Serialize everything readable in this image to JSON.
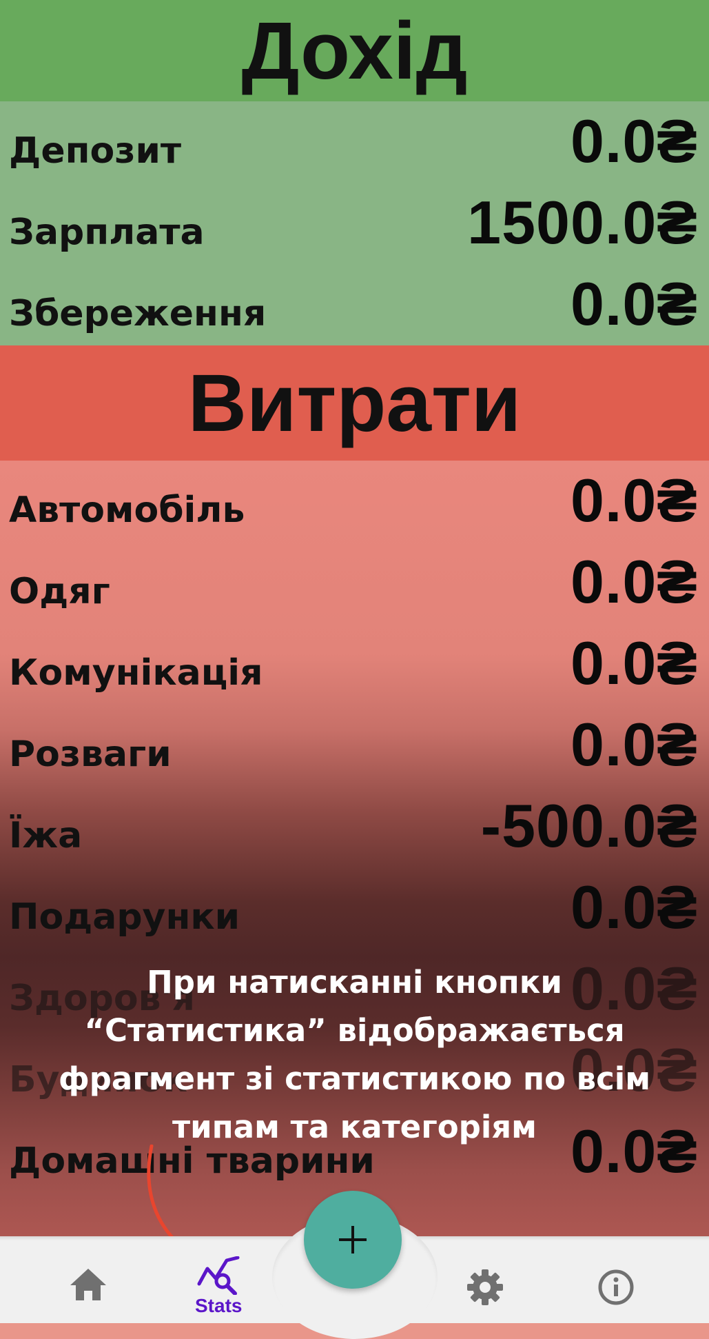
{
  "income": {
    "title": "Дохід",
    "items": [
      {
        "label": "Депозит",
        "value": "0.0₴"
      },
      {
        "label": "Зарплата",
        "value": "1500.0₴"
      },
      {
        "label": "Збереження",
        "value": "0.0₴"
      }
    ]
  },
  "expenses": {
    "title": "Витрати",
    "items": [
      {
        "label": "Автомобіль",
        "value": "0.0₴"
      },
      {
        "label": "Одяг",
        "value": "0.0₴"
      },
      {
        "label": "Комунікація",
        "value": "0.0₴"
      },
      {
        "label": "Розваги",
        "value": "0.0₴"
      },
      {
        "label": "Їжа",
        "value": "-500.0₴"
      },
      {
        "label": "Подарунки",
        "value": "0.0₴"
      },
      {
        "label": "Здоров'я",
        "value": "0.0₴"
      },
      {
        "label": "Будинок",
        "value": "0.0₴"
      },
      {
        "label": "Домашні тварини",
        "value": "0.0₴"
      }
    ]
  },
  "tutorial_overlay": {
    "text": "При натисканні кнопки “Статистика” відображається фрагмент зі статистикою по всім типам та категоріям"
  },
  "bottom_nav": {
    "items": [
      {
        "icon": "home-icon"
      },
      {
        "icon": "stats-icon",
        "label": "Stats",
        "active_color": "#5b16c9"
      },
      {
        "icon": "settings-icon"
      },
      {
        "icon": "info-icon"
      }
    ],
    "fab_icon": "plus-icon"
  },
  "colors": {
    "income_header": "#68aa5c",
    "income_body": "#89b585",
    "expense_header": "#e05e4f",
    "expense_body": "#e9877d",
    "fab": "#4fae9f",
    "nav_bar": "#f0f0f0"
  }
}
